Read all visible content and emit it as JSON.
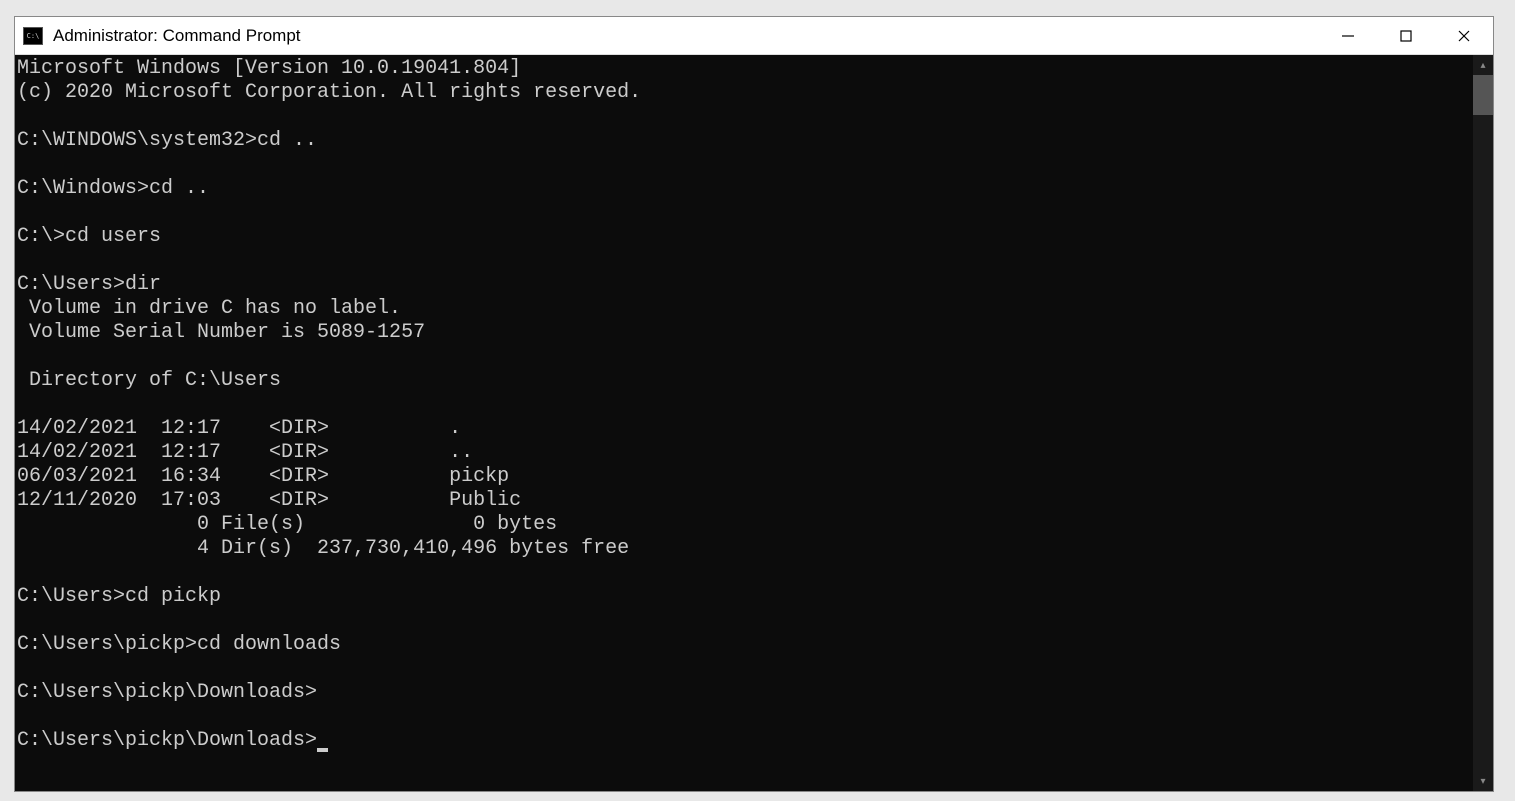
{
  "window": {
    "title": "Administrator: Command Prompt"
  },
  "terminal": {
    "lines": [
      "Microsoft Windows [Version 10.0.19041.804]",
      "(c) 2020 Microsoft Corporation. All rights reserved.",
      "",
      "C:\\WINDOWS\\system32>cd ..",
      "",
      "C:\\Windows>cd ..",
      "",
      "C:\\>cd users",
      "",
      "C:\\Users>dir",
      " Volume in drive C has no label.",
      " Volume Serial Number is 5089-1257",
      "",
      " Directory of C:\\Users",
      "",
      "14/02/2021  12:17    <DIR>          .",
      "14/02/2021  12:17    <DIR>          ..",
      "06/03/2021  16:34    <DIR>          pickp",
      "12/11/2020  17:03    <DIR>          Public",
      "               0 File(s)              0 bytes",
      "               4 Dir(s)  237,730,410,496 bytes free",
      "",
      "C:\\Users>cd pickp",
      "",
      "C:\\Users\\pickp>cd downloads",
      "",
      "C:\\Users\\pickp\\Downloads>",
      ""
    ],
    "current_prompt": "C:\\Users\\pickp\\Downloads>"
  }
}
